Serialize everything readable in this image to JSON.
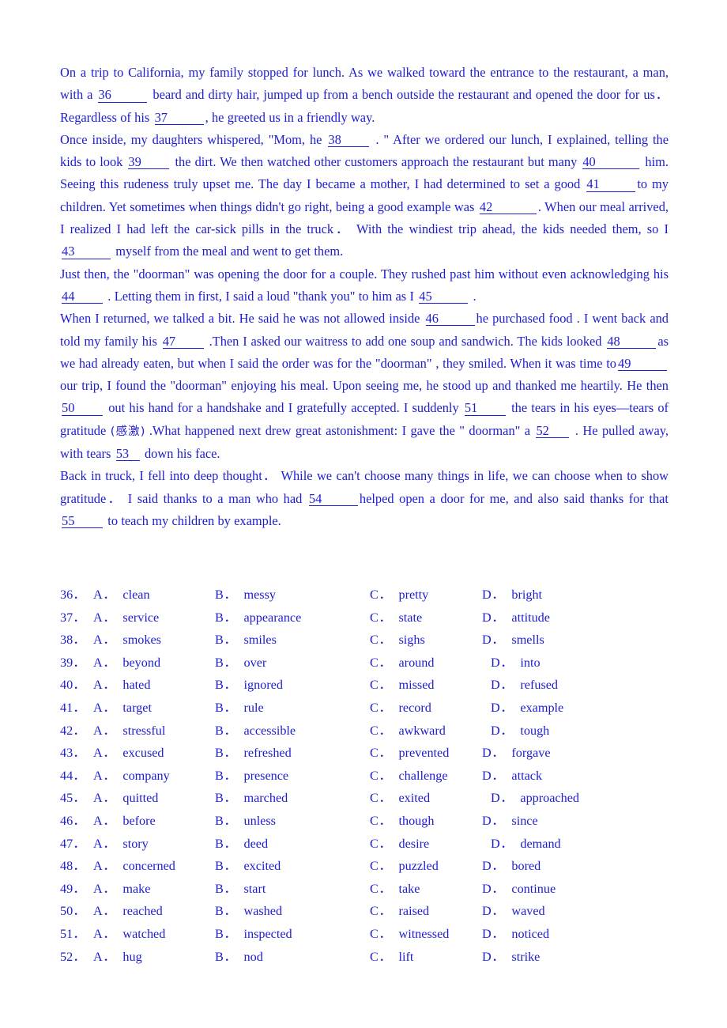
{
  "document": {
    "type": "english-cloze-test",
    "text_color": "#1d1dd0",
    "background_color": "#ffffff"
  },
  "passage": {
    "paragraphs": [
      {
        "id": "p1",
        "segments": [
          {
            "t": "text",
            "v": "On a trip to California, my family stopped for lunch. As we walked toward the entrance to the restaurant, a man, with a "
          },
          {
            "t": "blank",
            "v": "36",
            "w": "b-lg"
          },
          {
            "t": "text",
            "v": " beard and dirty hair, jumped up from a bench outside the restaurant and opened the door for us．  Regardless of his "
          },
          {
            "t": "blank",
            "v": "37",
            "w": "b-lg"
          },
          {
            "t": "text",
            "v": ", he greeted us in a friendly way."
          }
        ]
      },
      {
        "id": "p2",
        "segments": [
          {
            "t": "text",
            "v": "Once inside, my daughters whispered, \"Mom, he "
          },
          {
            "t": "blank",
            "v": "38",
            "w": "b-md"
          },
          {
            "t": "text",
            "v": " . \" After we ordered our lunch, I explained, telling the kids to look "
          },
          {
            "t": "blank",
            "v": "39",
            "w": "b-md"
          },
          {
            "t": "text",
            "v": " the dirt. We then watched other customers approach the restaurant but many "
          },
          {
            "t": "blank",
            "v": "40",
            "w": "b-xl"
          },
          {
            "t": "text",
            "v": " him. Seeing this rudeness truly upset me. The day I became a mother, I had determined to set a good "
          },
          {
            "t": "blank",
            "v": "41",
            "w": "b-lg"
          },
          {
            "t": "text",
            "v": "to my children. Yet sometimes when things didn't go right, being a good example was "
          },
          {
            "t": "blank",
            "v": "42",
            "w": "b-xl"
          },
          {
            "t": "text",
            "v": ". When our meal arrived, I realized I had left the car-sick pills in the truck． With the windiest trip ahead, the kids needed them, so I "
          },
          {
            "t": "blank",
            "v": "43",
            "w": "b-lg"
          },
          {
            "t": "text",
            "v": " myself from the meal and went to get them."
          }
        ]
      },
      {
        "id": "p3",
        "segments": [
          {
            "t": "text",
            "v": "Just then, the \"doorman\" was opening the door for a couple. They rushed past him without even acknowledging his "
          },
          {
            "t": "blank",
            "v": "44",
            "w": "b-md"
          },
          {
            "t": "text",
            "v": " . Letting them in first, I said a loud \"thank you\" to him as I "
          },
          {
            "t": "blank",
            "v": "45",
            "w": "b-lg"
          },
          {
            "t": "text",
            "v": " ."
          }
        ]
      },
      {
        "id": "p4",
        "segments": [
          {
            "t": "text",
            "v": "When I returned, we talked a bit. He said he was not allowed inside "
          },
          {
            "t": "blank",
            "v": "46",
            "w": "b-lg"
          },
          {
            "t": "text",
            "v": "he purchased food . I went back and told my family his "
          },
          {
            "t": "blank",
            "v": "47",
            "w": "b-md"
          },
          {
            "t": "text",
            "v": " .Then I asked our waitress to add one soup and sandwich. The kids looked "
          },
          {
            "t": "blank",
            "v": "48",
            "w": "b-lg"
          },
          {
            "t": "text",
            "v": "as we had already eaten, but when I said the order was for the \"doorman\" , they smiled. When it was time to"
          },
          {
            "t": "blank",
            "v": "49",
            "w": "b-lg"
          },
          {
            "t": "text",
            "v": " our trip, I found the \"doorman\" enjoying his meal. Upon seeing me, he stood up and thanked me heartily. He then "
          },
          {
            "t": "blank",
            "v": "50",
            "w": "b-md"
          },
          {
            "t": "text",
            "v": " out his hand for a handshake and I gratefully accepted. I suddenly "
          },
          {
            "t": "blank",
            "v": "51",
            "w": "b-md"
          },
          {
            "t": "text",
            "v": " the tears in his eyes—tears of gratitude "
          },
          {
            "t": "cn",
            "v": "(感激)"
          },
          {
            "t": "text",
            "v": " .What happened next drew great astonishment: I gave the \" doorman\" a "
          },
          {
            "t": "blank",
            "v": "52",
            "w": "b-sm"
          },
          {
            "t": "text",
            "v": " . He pulled away, with tears "
          },
          {
            "t": "blank",
            "v": "53",
            "w": "b-xs"
          },
          {
            "t": "text",
            "v": " down his face."
          }
        ]
      },
      {
        "id": "p5",
        "segments": [
          {
            "t": "text",
            "v": "Back in truck, I fell into deep thought．  While we can't choose many things in life, we can choose when to show gratitude．  I said thanks to a man who had "
          },
          {
            "t": "blank",
            "v": "54",
            "w": "b-lg"
          },
          {
            "t": "text",
            "v": "helped open a door for me, and also said thanks for that "
          },
          {
            "t": "blank",
            "v": "55",
            "w": "b-md"
          },
          {
            "t": "text",
            "v": " to teach my children by example."
          }
        ]
      }
    ]
  },
  "options": {
    "letters": [
      "A",
      "B",
      "C",
      "D"
    ],
    "rows": [
      {
        "num": "36．",
        "choices": [
          "clean",
          "messy",
          "pretty",
          "bright"
        ],
        "d_shift": false
      },
      {
        "num": "37．",
        "choices": [
          "service",
          "appearance",
          "state",
          "attitude"
        ],
        "d_shift": false
      },
      {
        "num": "38．",
        "choices": [
          "smokes",
          "smiles",
          "sighs",
          "smells"
        ],
        "d_shift": false
      },
      {
        "num": "39．",
        "choices": [
          "beyond",
          "over",
          "around",
          "into"
        ],
        "d_shift": true
      },
      {
        "num": "40．",
        "choices": [
          "hated",
          "ignored",
          "missed",
          "refused"
        ],
        "d_shift": true
      },
      {
        "num": "41．",
        "choices": [
          "target",
          "rule",
          "record",
          "example"
        ],
        "d_shift": true
      },
      {
        "num": "42．",
        "choices": [
          "stressful",
          "accessible",
          "awkward",
          "tough"
        ],
        "d_shift": true
      },
      {
        "num": "43．",
        "choices": [
          "excused",
          "refreshed",
          "prevented",
          "forgave"
        ],
        "d_shift": false
      },
      {
        "num": "44．",
        "choices": [
          "company",
          "presence",
          "challenge",
          "attack"
        ],
        "d_shift": false
      },
      {
        "num": "45．",
        "choices": [
          "quitted",
          "marched",
          "exited",
          "approached"
        ],
        "d_shift": true
      },
      {
        "num": "46．",
        "choices": [
          "before",
          "unless",
          "though",
          "since"
        ],
        "d_shift": false
      },
      {
        "num": "47．",
        "choices": [
          "story",
          "deed",
          "desire",
          "demand"
        ],
        "d_shift": true
      },
      {
        "num": "48．",
        "choices": [
          "concerned",
          "excited",
          "puzzled",
          "bored"
        ],
        "d_shift": false
      },
      {
        "num": "49．",
        "choices": [
          "make",
          "start",
          "take",
          "continue"
        ],
        "d_shift": false
      },
      {
        "num": "50．",
        "choices": [
          "reached",
          "washed",
          "raised",
          "waved"
        ],
        "d_shift": false
      },
      {
        "num": "51．",
        "choices": [
          "watched",
          "inspected",
          "witnessed",
          "noticed"
        ],
        "d_shift": false
      },
      {
        "num": "52．",
        "choices": [
          "hug",
          "nod",
          "lift",
          "strike"
        ],
        "d_shift": false
      }
    ]
  }
}
